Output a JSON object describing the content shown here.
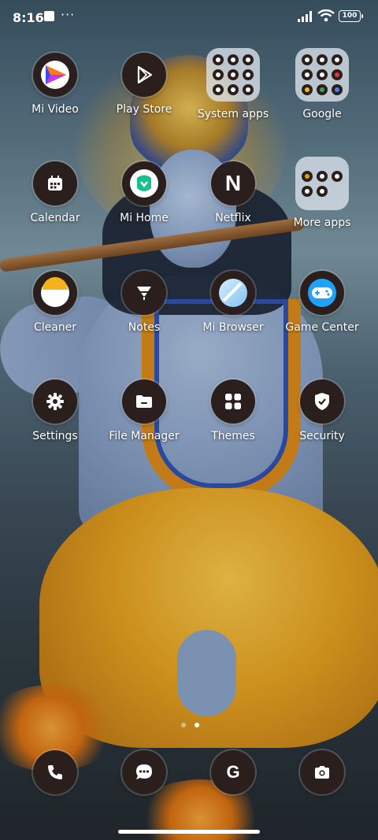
{
  "status_bar": {
    "time": "8:16",
    "more": "···",
    "battery": "100"
  },
  "apps": {
    "mi_video": "Mi Video",
    "play_store": "Play Store",
    "system_apps": "System apps",
    "google": "Google",
    "calendar": "Calendar",
    "mi_home": "Mi Home",
    "netflix": "Netflix",
    "more_apps": "More apps",
    "cleaner": "Cleaner",
    "notes": "Notes",
    "mi_browser": "Mi Browser",
    "game_center": "Game Center",
    "settings": "Settings",
    "file_manager": "File Manager",
    "themes": "Themes",
    "security": "Security"
  },
  "netflix_letter": "N",
  "google_letter": "G",
  "page_indicator": {
    "pages": 2,
    "current": 2
  },
  "icons": {
    "dock": [
      "phone-icon",
      "messages-icon",
      "google-search-icon",
      "camera-icon"
    ]
  }
}
